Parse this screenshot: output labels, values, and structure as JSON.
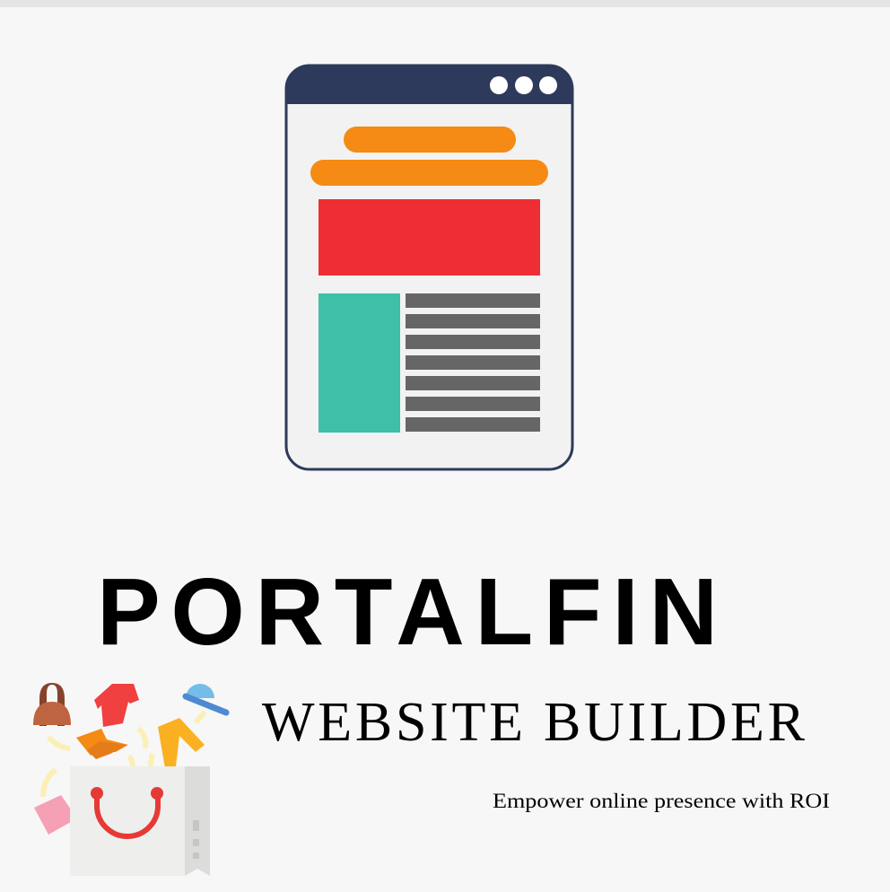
{
  "brand": {
    "name": "PORTALFIN",
    "subtitle": "WEBSITE BUILDER",
    "tagline": "Empower online presence with ROI"
  },
  "colors": {
    "background": "#f7f7f7",
    "window_header": "#2d3a5b",
    "orange": "#f58a14",
    "red": "#ee2e34",
    "teal": "#3dbfa8",
    "gray_lines": "#666666",
    "text": "#000000"
  },
  "icons": [
    "browser-window-icon",
    "shopping-bag-icon"
  ]
}
